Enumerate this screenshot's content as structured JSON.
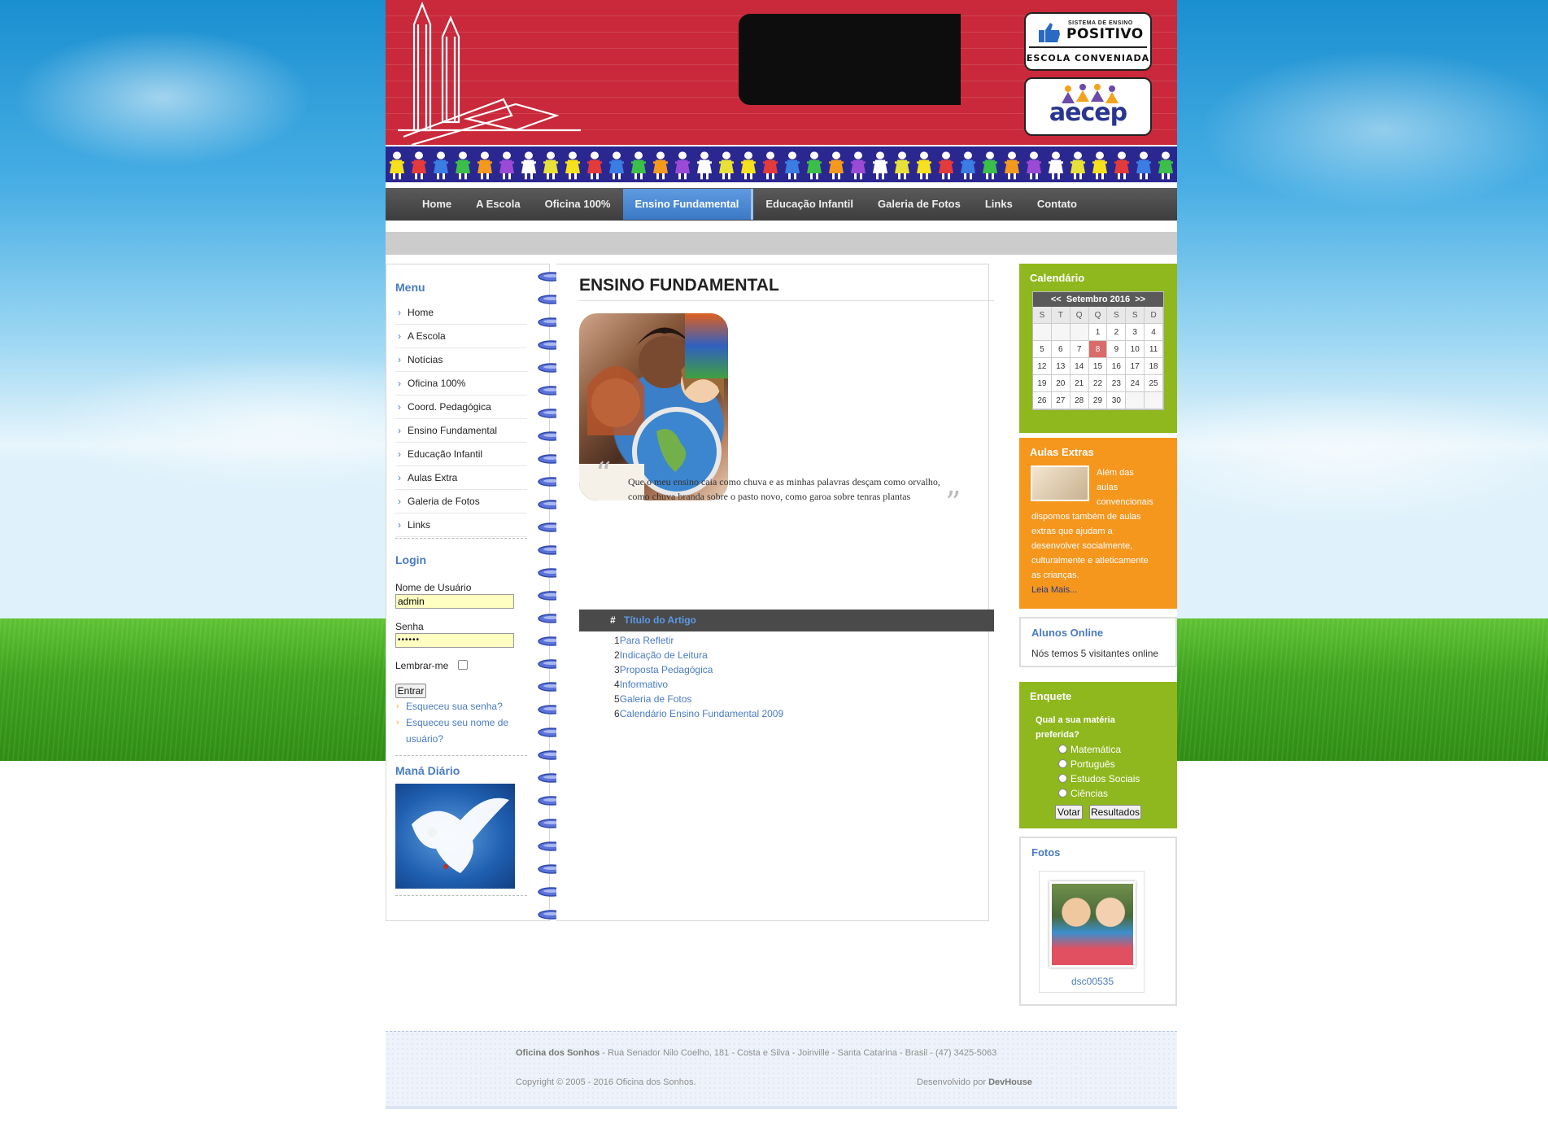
{
  "header": {
    "positivo_small": "SISTEMA DE ENSINO",
    "positivo_big": "POSITIVO",
    "positivo_conv": "ESCOLA CONVENIADA",
    "aecep": "aecep"
  },
  "nav": {
    "items": [
      "Home",
      "A Escola",
      "Oficina 100%",
      "Ensino Fundamental",
      "Educação Infantil",
      "Galeria de Fotos",
      "Links",
      "Contato"
    ],
    "active": "Ensino Fundamental"
  },
  "left": {
    "menu_title": "Menu",
    "menu_items": [
      "Home",
      "A Escola",
      "Notícias",
      "Oficina 100%",
      "Coord. Pedagógica",
      "Ensino Fundamental",
      "Educação Infantil",
      "Aulas Extra",
      "Galeria de Fotos",
      "Links"
    ],
    "login_title": "Login",
    "username_label": "Nome de Usuário",
    "username_value": "admin",
    "password_label": "Senha",
    "password_value": "••••••",
    "remember_label": "Lembrar-me",
    "submit_label": "Entrar",
    "forgot_password": "Esqueceu sua senha?",
    "forgot_username_1": "Esqueceu seu nome de",
    "forgot_username_2": "usuário?",
    "mana_title": "Maná Diário"
  },
  "main": {
    "title": "ENSINO FUNDAMENTAL",
    "quote": "Que o meu ensino caia como chuva e as minhas palavras desçam como orvalho, como chuva branda sobre o pasto novo, como garoa sobre tenras plantas",
    "table_hash": "#",
    "table_header": "Título do Artigo",
    "articles": [
      {
        "num": "1",
        "title": "Para Refletir"
      },
      {
        "num": "2",
        "title": "Indicação de Leitura"
      },
      {
        "num": "3",
        "title": "Proposta Pedagógica"
      },
      {
        "num": "4",
        "title": "Informativo"
      },
      {
        "num": "5",
        "title": "Galeria de Fotos"
      },
      {
        "num": "6",
        "title": "Calendário Ensino Fundamental 2009"
      }
    ]
  },
  "right": {
    "calendar_title": "Calendário",
    "calendar_month": "Setembro 2016",
    "calendar_prev": "<<",
    "calendar_next": ">>",
    "calendar_dow": [
      "S",
      "T",
      "Q",
      "Q",
      "S",
      "S",
      "D"
    ],
    "calendar_days": [
      "",
      "",
      "",
      "1",
      "2",
      "3",
      "4",
      "5",
      "6",
      "7",
      "8",
      "9",
      "10",
      "11",
      "12",
      "13",
      "14",
      "15",
      "16",
      "17",
      "18",
      "19",
      "20",
      "21",
      "22",
      "23",
      "24",
      "25",
      "26",
      "27",
      "28",
      "29",
      "30",
      "",
      ""
    ],
    "calendar_today": "8",
    "aulas_title": "Aulas Extras",
    "aulas_lines": [
      "Além das",
      "aulas",
      "convencionais",
      "dispomos também de aulas",
      "extras que ajudam a",
      "desenvolver socialmente,",
      "culturalmente e atleticamente",
      "as crianças."
    ],
    "aulas_more": "Leia Mais...",
    "online_title": "Alunos Online",
    "online_text": "Nós temos 5 visitantes online",
    "poll_title": "Enquete",
    "poll_question_1": "Qual a sua matéria",
    "poll_question_2": "preferida?",
    "poll_options": [
      "Matemática",
      "Português",
      "Estudos Sociais",
      "Ciências"
    ],
    "poll_vote": "Votar",
    "poll_results": "Resultados",
    "fotos_title": "Fotos",
    "foto_caption": "dsc00535"
  },
  "footer": {
    "org": "Oficina dos Sonhos",
    "address": " - Rua Senador Nilo Coelho, 181 - Costa e Silva - Joinville - Santa Catarina - Brasil - (47) 3425-5063",
    "copyright": "Copyright © 2005 - 2016 Oficina dos Sonhos.",
    "dev_prefix": "Desenvolvido por ",
    "dev_name": "DevHouse"
  }
}
